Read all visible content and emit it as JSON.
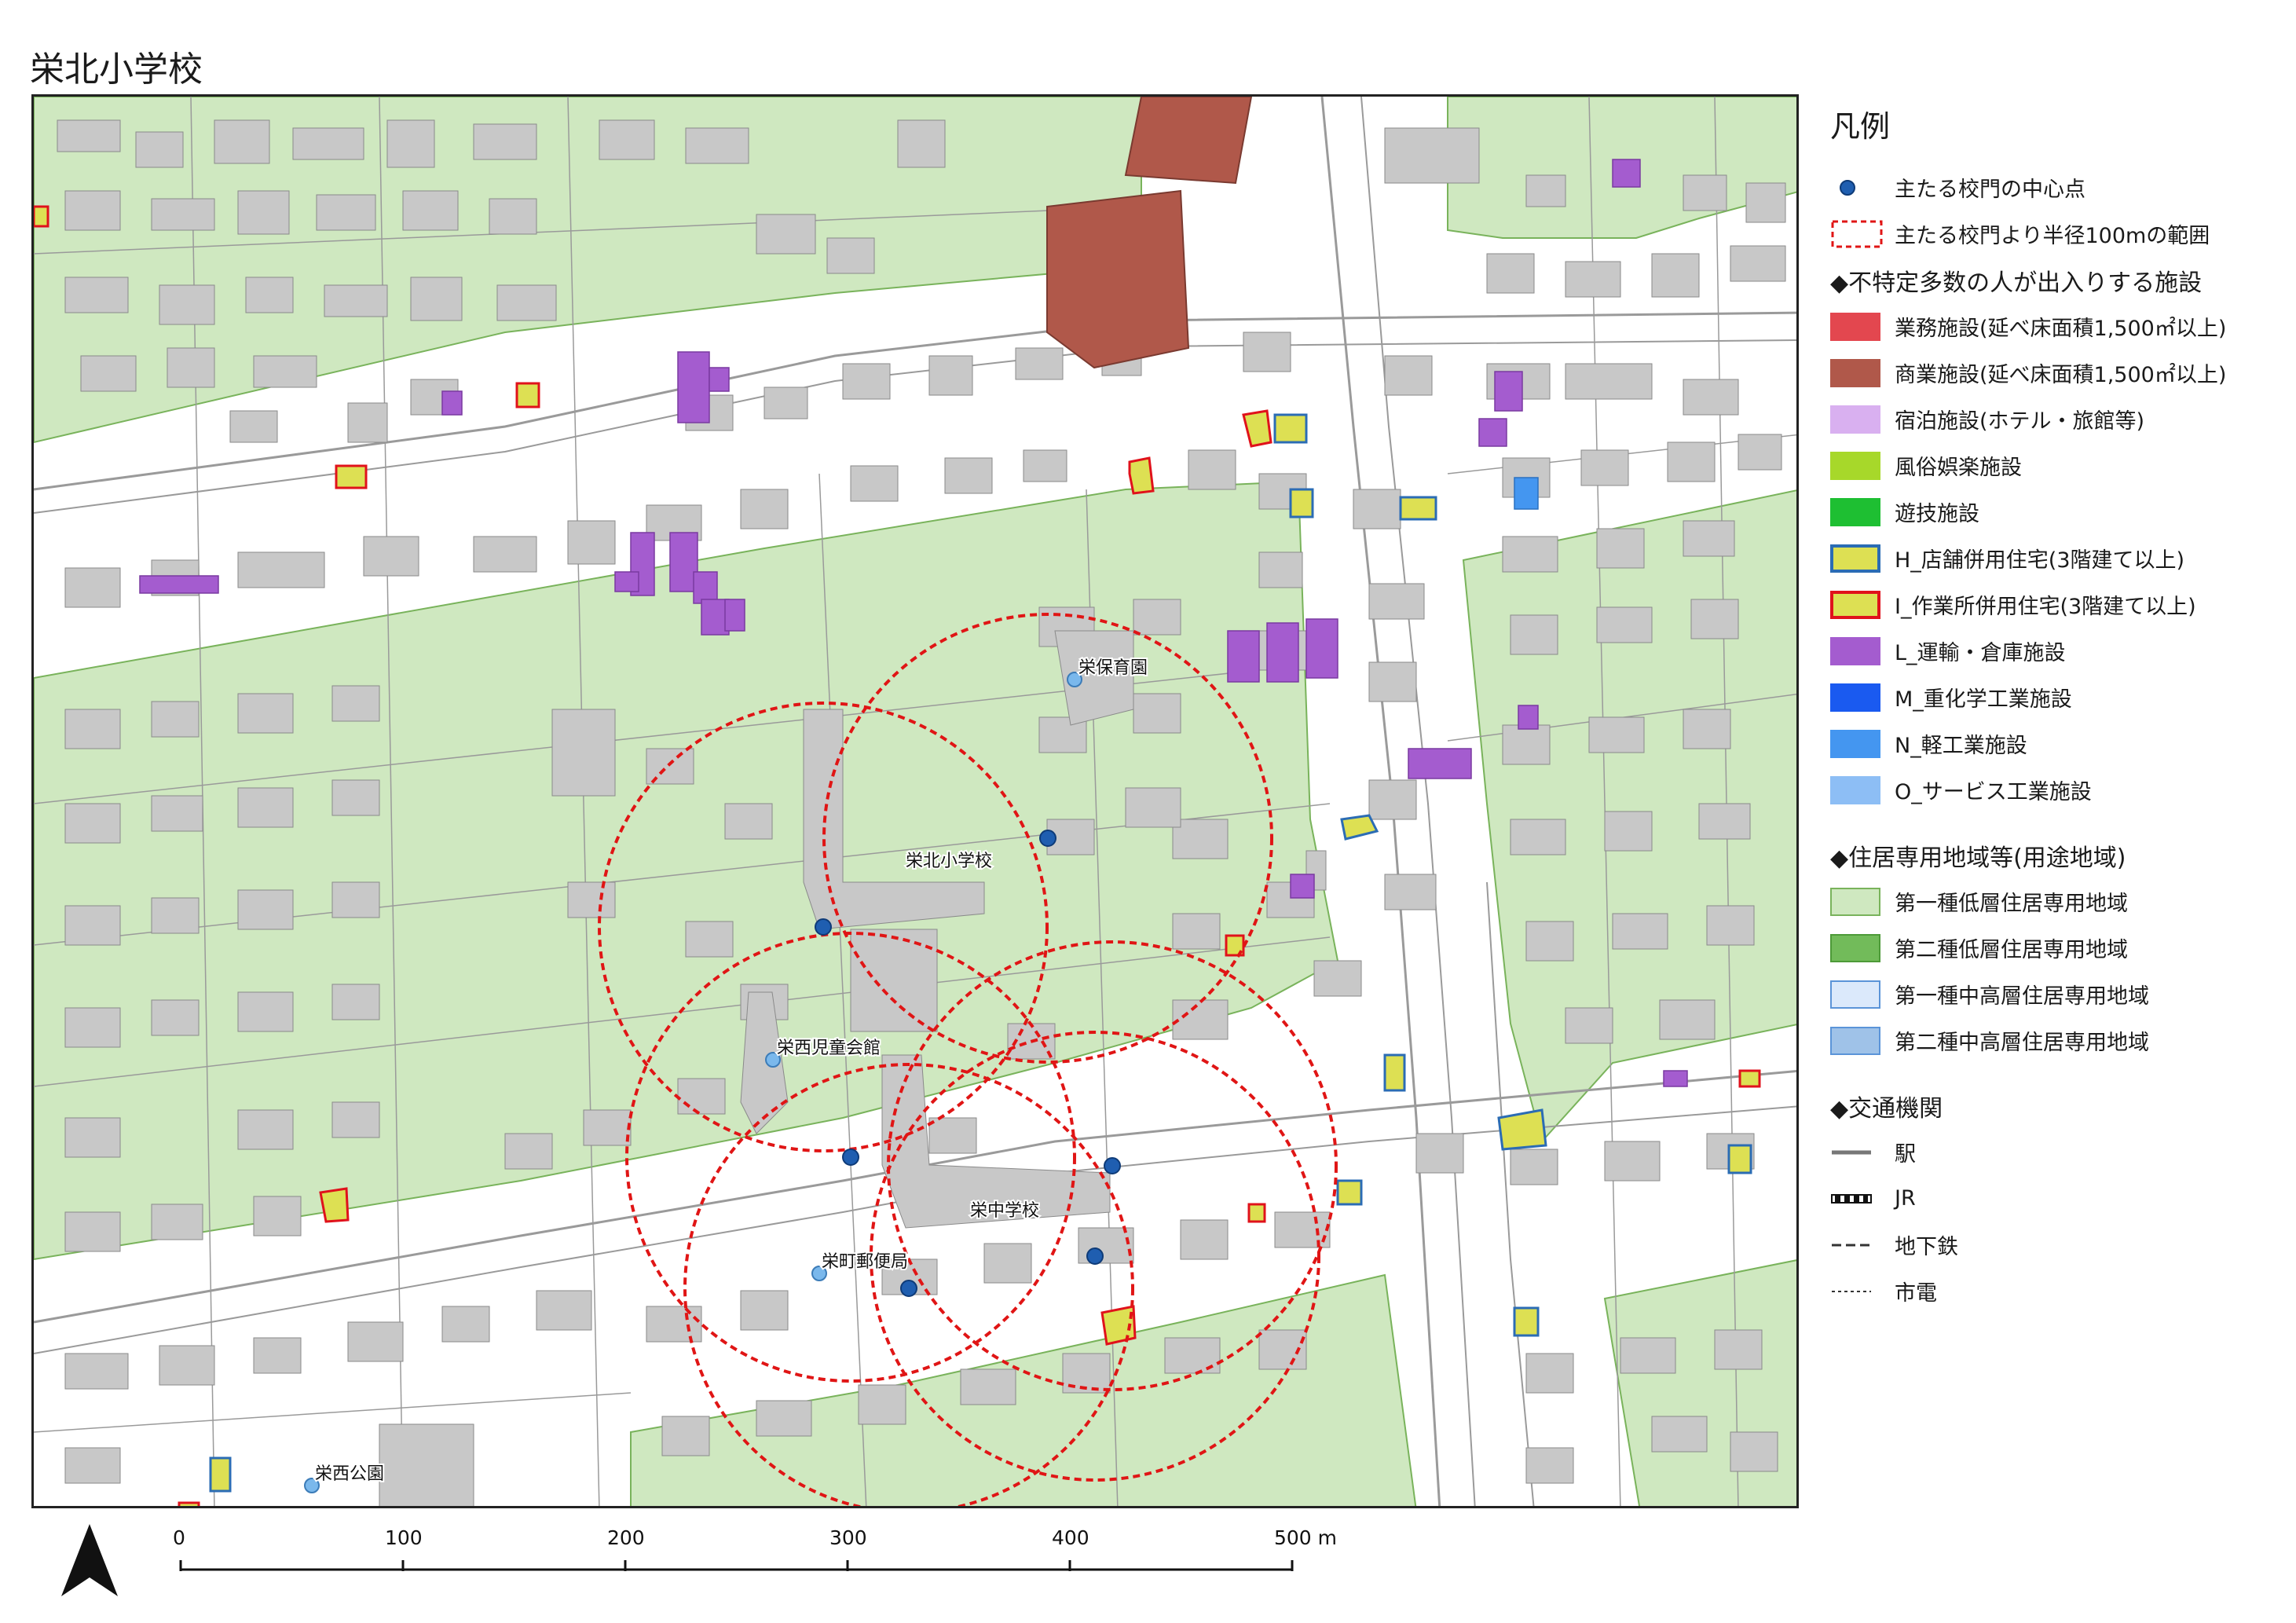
{
  "title": "栄北小学校",
  "map": {
    "labels": {
      "school_north": "栄北小学校",
      "school_middle": "栄中学校",
      "nursery": "栄保育園",
      "childrens_hall": "栄西児童会館",
      "post_office": "栄町郵便局",
      "park": "栄西公園"
    },
    "colors": {
      "residential_1_low": "#cfe8c0",
      "building": "#c8c8c8",
      "commercial": "#b0584a",
      "warehouse": "#a45ccf",
      "light_industry": "#4496f0",
      "shop_house_fill": "#dde053",
      "shop_house_outline": "#2b6cb4",
      "workshop_house_outline": "#e0121b",
      "gate_point": "#1f5eb0",
      "buffer_circle": "#e01515",
      "facility_point": "#7ab8ec"
    }
  },
  "legend": {
    "title": "凡例",
    "gate_point": "主たる校門の中心点",
    "buffer": "主たる校門より半径100mの範囲",
    "section_facilities": "◆不特定多数の人が出入りする施設",
    "business": "業務施設(延べ床面積1,500㎡以上)",
    "commercial": "商業施設(延べ床面積1,500㎡以上)",
    "lodging": "宿泊施設(ホテル・旅館等)",
    "adult_entertainment": "風俗娯楽施設",
    "amusement": "遊技施設",
    "shop_house": "H_店舗併用住宅(3階建て以上)",
    "workshop_house": "I_作業所併用住宅(3階建て以上)",
    "transport_warehouse": "L_運輸・倉庫施設",
    "heavy_chemical": "M_重化学工業施設",
    "light_industry": "N_軽工業施設",
    "service_industry": "O_サービス工業施設",
    "section_zoning": "◆住居専用地域等(用途地域)",
    "zone1_low": "第一種低層住居専用地域",
    "zone2_low": "第二種低層住居専用地域",
    "zone1_midhigh": "第一種中高層住居専用地域",
    "zone2_midhigh": "第二種中高層住居専用地域",
    "section_transport": "◆交通機関",
    "station": "駅",
    "jr": "JR",
    "subway": "地下鉄",
    "tram": "市電",
    "colors": {
      "business": "#e3474f",
      "commercial": "#b0584a",
      "lodging": "#d9b0f0",
      "adult_entertainment": "#a7d82a",
      "amusement": "#1ebf32",
      "shop_house": "#dde053",
      "shop_house_border": "#2b6cb4",
      "workshop_house": "#dde053",
      "workshop_house_border": "#e0121b",
      "transport_warehouse": "#a45ccf",
      "heavy_chemical": "#1a5af0",
      "light_industry": "#4496f0",
      "service_industry": "#8dbef5",
      "zone1_low": "#cfe8c0",
      "zone1_low_border": "#79b35b",
      "zone2_low": "#72bb5a",
      "zone2_low_border": "#4d9a38",
      "zone1_midhigh": "#dbe9fb",
      "zone1_midhigh_border": "#5b94d8",
      "zone2_midhigh": "#9fc2e8",
      "zone2_midhigh_border": "#5b94d8"
    }
  },
  "scale": {
    "ticks": [
      "0",
      "100",
      "200",
      "300",
      "400",
      "500 m"
    ]
  }
}
